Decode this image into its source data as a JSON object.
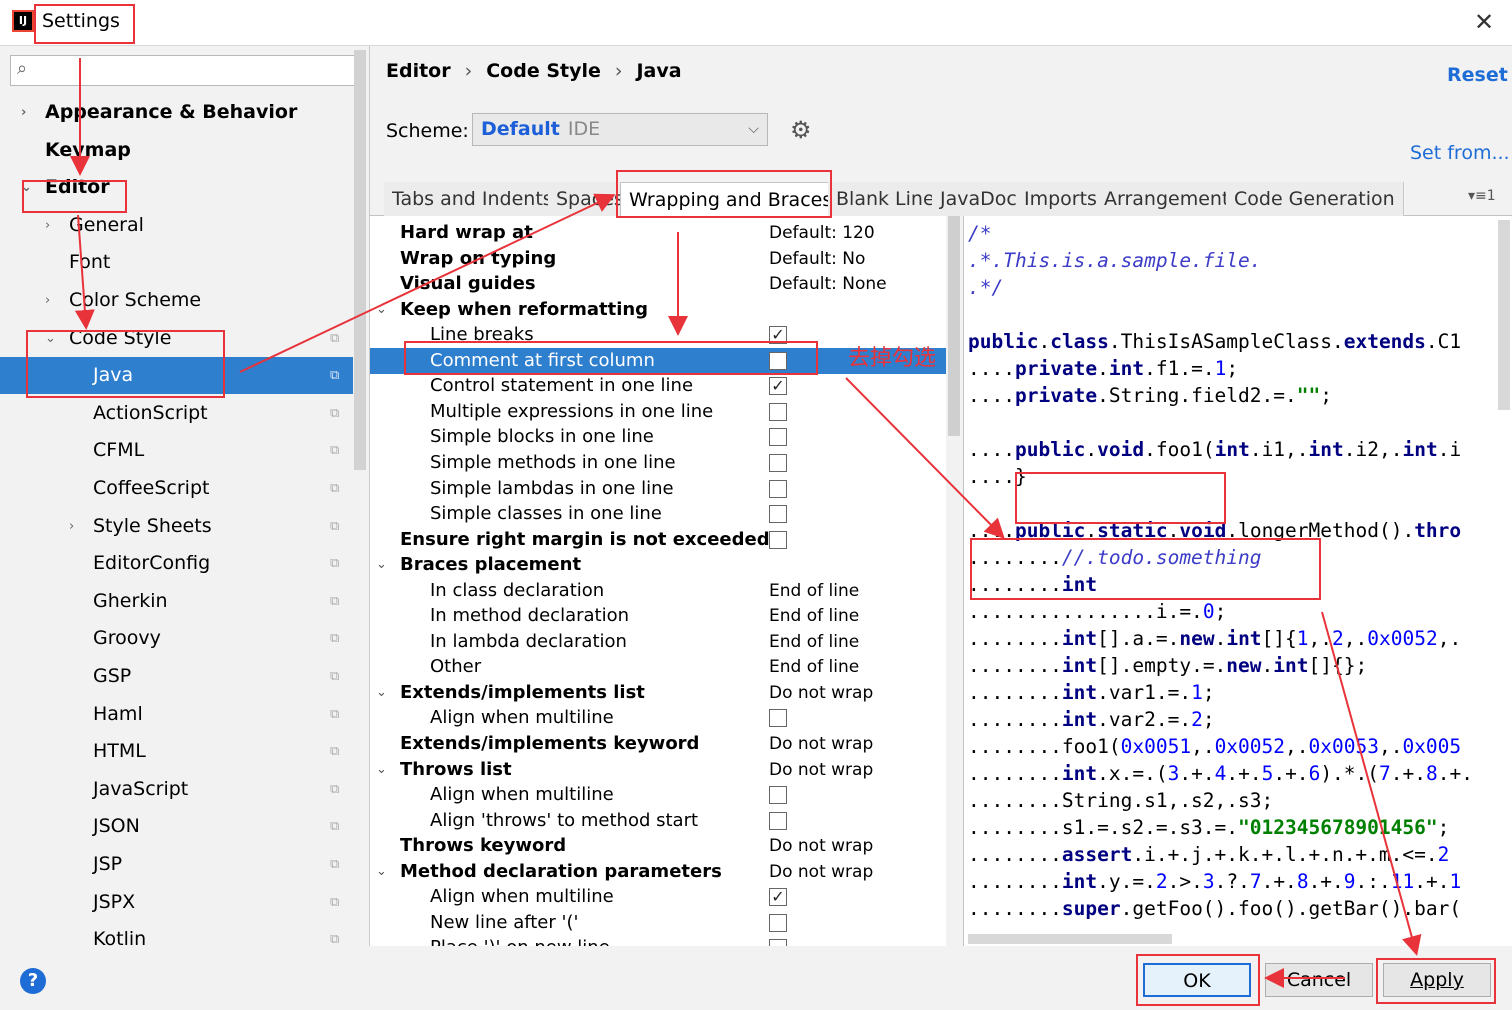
{
  "window": {
    "title": "Settings",
    "app_icon": "IJ"
  },
  "search": {
    "placeholder": ""
  },
  "sidebar": {
    "items": [
      {
        "label": "Appearance & Behavior",
        "bold": true,
        "arrow": "›"
      },
      {
        "label": "Keymap",
        "bold": true
      },
      {
        "label": "Editor",
        "bold": true,
        "arrow": "⌄"
      },
      {
        "label": "General",
        "arrow": "›"
      },
      {
        "label": "Font"
      },
      {
        "label": "Color Scheme",
        "arrow": "›"
      },
      {
        "label": "Code Style",
        "arrow": "⌄",
        "copy": true
      },
      {
        "label": "Java",
        "copy": true,
        "selected": true
      },
      {
        "label": "ActionScript",
        "copy": true
      },
      {
        "label": "CFML",
        "copy": true
      },
      {
        "label": "CoffeeScript",
        "copy": true
      },
      {
        "label": "Style Sheets",
        "arrow": "›",
        "copy": true
      },
      {
        "label": "EditorConfig",
        "copy": true
      },
      {
        "label": "Gherkin",
        "copy": true
      },
      {
        "label": "Groovy",
        "copy": true
      },
      {
        "label": "GSP",
        "copy": true
      },
      {
        "label": "Haml",
        "copy": true
      },
      {
        "label": "HTML",
        "copy": true
      },
      {
        "label": "JavaScript",
        "copy": true
      },
      {
        "label": "JSON",
        "copy": true
      },
      {
        "label": "JSP",
        "copy": true
      },
      {
        "label": "JSPX",
        "copy": true
      },
      {
        "label": "Kotlin",
        "copy": true
      }
    ]
  },
  "breadcrumb": {
    "part1": "Editor",
    "part2": "Code Style",
    "part3": "Java",
    "sep": "›"
  },
  "header": {
    "reset_label": "Reset",
    "set_from_label": "Set from..."
  },
  "scheme": {
    "label": "Scheme:",
    "name": "Default",
    "type": "IDE"
  },
  "tabs": [
    "Tabs and Indents",
    "Spaces",
    "Wrapping and Braces",
    "Blank Lines",
    "JavaDoc",
    "Imports",
    "Arrangement",
    "Code Generation"
  ],
  "active_tab": 2,
  "tab_more": "▾≡1",
  "settings": [
    {
      "label": "Hard wrap at",
      "bold": true,
      "value": "Default: 120"
    },
    {
      "label": "Wrap on typing",
      "bold": true,
      "value": "Default: No"
    },
    {
      "label": "Visual guides",
      "bold": true,
      "value": "Default: None"
    },
    {
      "label": "Keep when reformatting",
      "bold": true,
      "arrow": true
    },
    {
      "label": "Line breaks",
      "indent": true,
      "checked": true
    },
    {
      "label": "Comment at first column",
      "indent": true,
      "checked": false,
      "selected": true
    },
    {
      "label": "Control statement in one line",
      "indent": true,
      "checked": true
    },
    {
      "label": "Multiple expressions in one line",
      "indent": true,
      "checked": false
    },
    {
      "label": "Simple blocks in one line",
      "indent": true,
      "checked": false
    },
    {
      "label": "Simple methods in one line",
      "indent": true,
      "checked": false
    },
    {
      "label": "Simple lambdas in one line",
      "indent": true,
      "checked": false
    },
    {
      "label": "Simple classes in one line",
      "indent": true,
      "checked": false
    },
    {
      "label": "Ensure right margin is not exceeded",
      "bold": true,
      "checked": false
    },
    {
      "label": "Braces placement",
      "bold": true,
      "arrow": true
    },
    {
      "label": "In class declaration",
      "indent": true,
      "value": "End of line"
    },
    {
      "label": "In method declaration",
      "indent": true,
      "value": "End of line"
    },
    {
      "label": "In lambda declaration",
      "indent": true,
      "value": "End of line"
    },
    {
      "label": "Other",
      "indent": true,
      "value": "End of line"
    },
    {
      "label": "Extends/implements list",
      "bold": true,
      "arrow": true,
      "value": "Do not wrap"
    },
    {
      "label": "Align when multiline",
      "indent": true,
      "checked": false
    },
    {
      "label": "Extends/implements keyword",
      "bold": true,
      "value": "Do not wrap"
    },
    {
      "label": "Throws list",
      "bold": true,
      "arrow": true,
      "value": "Do not wrap"
    },
    {
      "label": "Align when multiline",
      "indent": true,
      "checked": false
    },
    {
      "label": "Align 'throws' to method start",
      "indent": true,
      "checked": false
    },
    {
      "label": "Throws keyword",
      "bold": true,
      "value": "Do not wrap"
    },
    {
      "label": "Method declaration parameters",
      "bold": true,
      "arrow": true,
      "value": "Do not wrap"
    },
    {
      "label": "Align when multiline",
      "indent": true,
      "checked": true
    },
    {
      "label": "New line after '('",
      "indent": true,
      "checked": false
    },
    {
      "label": "Place ')' on new line",
      "indent": true,
      "checked": false
    }
  ],
  "code_lines": [
    [
      {
        "t": "/*",
        "c": "cm"
      }
    ],
    [
      {
        "t": ".*.This.is.a.sample.file.",
        "c": "cm"
      }
    ],
    [
      {
        "t": ".*/",
        "c": "cm"
      }
    ],
    [],
    [
      {
        "t": "public",
        "c": "kw"
      },
      {
        "t": ".",
        "c": ""
      },
      {
        "t": "class",
        "c": "kw"
      },
      {
        "t": ".ThisIsASampleClass.",
        "c": ""
      },
      {
        "t": "extends",
        "c": "kw"
      },
      {
        "t": ".C1",
        "c": ""
      }
    ],
    [
      {
        "t": "....",
        "c": ""
      },
      {
        "t": "private",
        "c": "kw"
      },
      {
        "t": ".",
        "c": ""
      },
      {
        "t": "int",
        "c": "kw"
      },
      {
        "t": ".f1.=.",
        "c": ""
      },
      {
        "t": "1",
        "c": "num"
      },
      {
        "t": ";",
        "c": ""
      }
    ],
    [
      {
        "t": "....",
        "c": ""
      },
      {
        "t": "private",
        "c": "kw"
      },
      {
        "t": ".String.field2.=.",
        "c": ""
      },
      {
        "t": "\"\"",
        "c": "str"
      },
      {
        "t": ";",
        "c": ""
      }
    ],
    [],
    [
      {
        "t": "....",
        "c": ""
      },
      {
        "t": "public",
        "c": "kw"
      },
      {
        "t": ".",
        "c": ""
      },
      {
        "t": "void",
        "c": "kw"
      },
      {
        "t": ".foo1(",
        "c": ""
      },
      {
        "t": "int",
        "c": "kw"
      },
      {
        "t": ".i1,.",
        "c": ""
      },
      {
        "t": "int",
        "c": "kw"
      },
      {
        "t": ".i2,.",
        "c": ""
      },
      {
        "t": "int",
        "c": "kw"
      },
      {
        "t": ".i",
        "c": ""
      }
    ],
    [
      {
        "t": "....}",
        "c": ""
      }
    ],
    [],
    [
      {
        "t": "....",
        "c": ""
      },
      {
        "t": "public",
        "c": "kw"
      },
      {
        "t": ".",
        "c": ""
      },
      {
        "t": "static",
        "c": "kw"
      },
      {
        "t": ".",
        "c": ""
      },
      {
        "t": "void",
        "c": "kw"
      },
      {
        "t": ".longerMethod().",
        "c": ""
      },
      {
        "t": "thro",
        "c": "kw"
      }
    ],
    [
      {
        "t": "........",
        "c": ""
      },
      {
        "t": "//.todo.something",
        "c": "cm"
      }
    ],
    [
      {
        "t": "........",
        "c": ""
      },
      {
        "t": "int",
        "c": "kw"
      }
    ],
    [
      {
        "t": "................i.=.",
        "c": ""
      },
      {
        "t": "0",
        "c": "num"
      },
      {
        "t": ";",
        "c": ""
      }
    ],
    [
      {
        "t": "........",
        "c": ""
      },
      {
        "t": "int",
        "c": "kw"
      },
      {
        "t": "[].a.=.",
        "c": ""
      },
      {
        "t": "new",
        "c": "kw"
      },
      {
        "t": ".",
        "c": ""
      },
      {
        "t": "int",
        "c": "kw"
      },
      {
        "t": "[]{",
        "c": ""
      },
      {
        "t": "1",
        "c": "num"
      },
      {
        "t": ",.",
        "c": ""
      },
      {
        "t": "2",
        "c": "num"
      },
      {
        "t": ",.",
        "c": ""
      },
      {
        "t": "0x0052",
        "c": "num"
      },
      {
        "t": ",.",
        "c": ""
      }
    ],
    [
      {
        "t": "........",
        "c": ""
      },
      {
        "t": "int",
        "c": "kw"
      },
      {
        "t": "[].empty.=.",
        "c": ""
      },
      {
        "t": "new",
        "c": "kw"
      },
      {
        "t": ".",
        "c": ""
      },
      {
        "t": "int",
        "c": "kw"
      },
      {
        "t": "[]{};",
        "c": ""
      }
    ],
    [
      {
        "t": "........",
        "c": ""
      },
      {
        "t": "int",
        "c": "kw"
      },
      {
        "t": ".var1.=.",
        "c": ""
      },
      {
        "t": "1",
        "c": "num"
      },
      {
        "t": ";",
        "c": ""
      }
    ],
    [
      {
        "t": "........",
        "c": ""
      },
      {
        "t": "int",
        "c": "kw"
      },
      {
        "t": ".var2.=.",
        "c": ""
      },
      {
        "t": "2",
        "c": "num"
      },
      {
        "t": ";",
        "c": ""
      }
    ],
    [
      {
        "t": "........foo1(",
        "c": ""
      },
      {
        "t": "0x0051",
        "c": "num"
      },
      {
        "t": ",.",
        "c": ""
      },
      {
        "t": "0x0052",
        "c": "num"
      },
      {
        "t": ",.",
        "c": ""
      },
      {
        "t": "0x0053",
        "c": "num"
      },
      {
        "t": ",.",
        "c": ""
      },
      {
        "t": "0x005",
        "c": "num"
      }
    ],
    [
      {
        "t": "........",
        "c": ""
      },
      {
        "t": "int",
        "c": "kw"
      },
      {
        "t": ".x.=.(",
        "c": ""
      },
      {
        "t": "3",
        "c": "num"
      },
      {
        "t": ".+.",
        "c": ""
      },
      {
        "t": "4",
        "c": "num"
      },
      {
        "t": ".+.",
        "c": ""
      },
      {
        "t": "5",
        "c": "num"
      },
      {
        "t": ".+.",
        "c": ""
      },
      {
        "t": "6",
        "c": "num"
      },
      {
        "t": ").*.(",
        "c": ""
      },
      {
        "t": "7",
        "c": "num"
      },
      {
        "t": ".+.",
        "c": ""
      },
      {
        "t": "8",
        "c": "num"
      },
      {
        "t": ".+.",
        "c": ""
      }
    ],
    [
      {
        "t": "........String.s1,.s2,.s3;",
        "c": ""
      }
    ],
    [
      {
        "t": "........s1.=.s2.=.s3.=.",
        "c": ""
      },
      {
        "t": "\"012345678901456\"",
        "c": "str"
      },
      {
        "t": ";",
        "c": ""
      }
    ],
    [
      {
        "t": "........",
        "c": ""
      },
      {
        "t": "assert",
        "c": "kw"
      },
      {
        "t": ".i.+.j.+.k.+.l.+.n.+.m.<=.",
        "c": ""
      },
      {
        "t": "2",
        "c": "num"
      }
    ],
    [
      {
        "t": "........",
        "c": ""
      },
      {
        "t": "int",
        "c": "kw"
      },
      {
        "t": ".y.=.",
        "c": ""
      },
      {
        "t": "2",
        "c": "num"
      },
      {
        "t": ".>.",
        "c": ""
      },
      {
        "t": "3",
        "c": "num"
      },
      {
        "t": ".?.",
        "c": ""
      },
      {
        "t": "7",
        "c": "num"
      },
      {
        "t": ".+.",
        "c": ""
      },
      {
        "t": "8",
        "c": "num"
      },
      {
        "t": ".+.",
        "c": ""
      },
      {
        "t": "9",
        "c": "num"
      },
      {
        "t": ".:.",
        "c": ""
      },
      {
        "t": "11",
        "c": "num"
      },
      {
        "t": ".+.",
        "c": ""
      },
      {
        "t": "1",
        "c": "num"
      }
    ],
    [
      {
        "t": "........",
        "c": ""
      },
      {
        "t": "super",
        "c": "kw"
      },
      {
        "t": ".getFoo().foo().getBar().bar(",
        "c": ""
      }
    ]
  ],
  "buttons": {
    "ok": "OK",
    "cancel": "Cancel",
    "apply": "Apply",
    "help": "?"
  },
  "annotation": {
    "text": "去掉勾选"
  },
  "colors": {
    "accent": "#2f7fcf",
    "link": "#1e6cd6",
    "annotation": "#e8333a"
  }
}
